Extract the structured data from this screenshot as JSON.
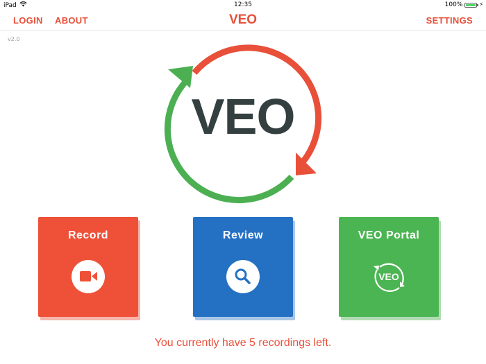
{
  "status_bar": {
    "device": "iPad",
    "time": "12:35",
    "battery": "100%",
    "wifi_icon": "wifi-icon",
    "battery_icon": "battery-icon"
  },
  "nav": {
    "login_label": "LOGIN",
    "about_label": "ABOUT",
    "title": "VEO",
    "settings_label": "SETTINGS"
  },
  "version": "v2.0",
  "logo": {
    "text": "VEO",
    "arrow_colors": {
      "red": "#e8503a",
      "green": "#4cb053"
    }
  },
  "tiles": [
    {
      "label": "Record",
      "icon": "video-camera-icon",
      "color": "#ee5138",
      "shadow": "#f6b5aa"
    },
    {
      "label": "Review",
      "icon": "magnifier-icon",
      "color": "#2471c3",
      "shadow": "#a9c6e7"
    },
    {
      "label": "VEO Portal",
      "icon": "veo-logo-icon",
      "icon_text": "VEO",
      "color": "#4cb553",
      "shadow": "#b1dcb3"
    }
  ],
  "footer": {
    "message": "You currently have 5 recordings left."
  }
}
